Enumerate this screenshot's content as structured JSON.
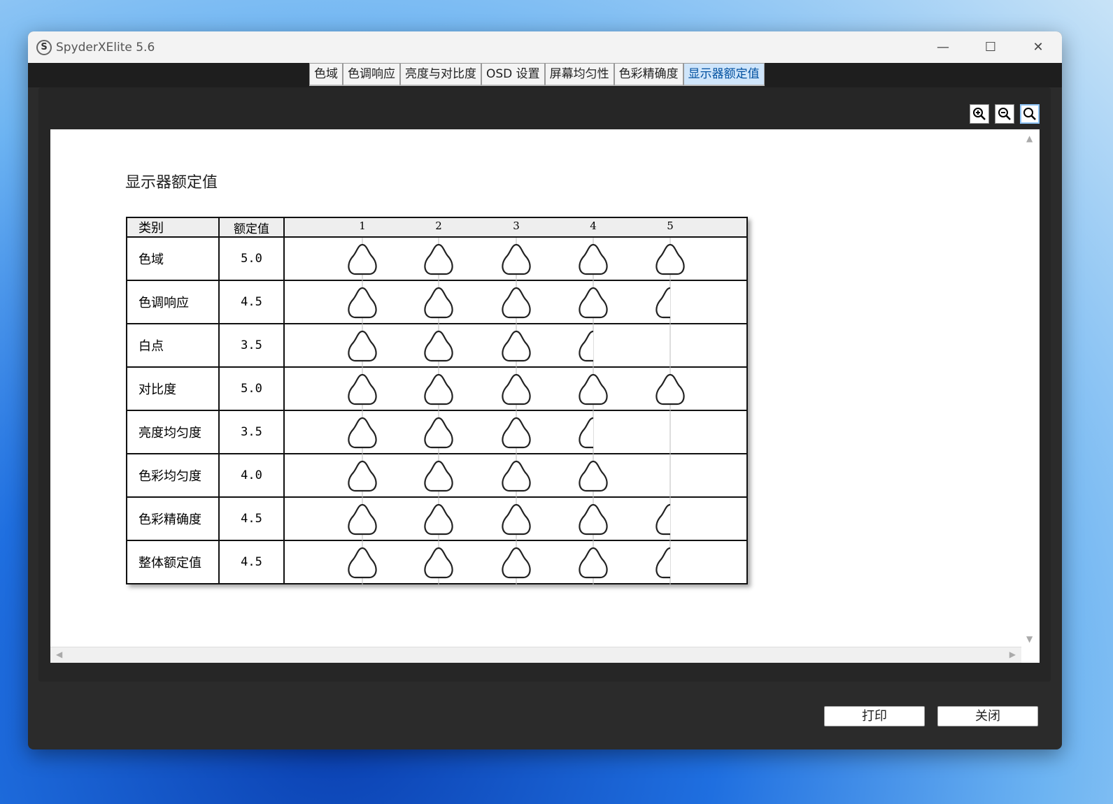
{
  "window": {
    "title": "SpyderXElite 5.6",
    "logo": "S"
  },
  "tabs": [
    "色域",
    "色调响应",
    "亮度与对比度",
    "OSD 设置",
    "屏幕均匀性",
    "色彩精确度",
    "显示器额定值"
  ],
  "active_tab": 6,
  "doc": {
    "title": "显示器额定值",
    "headers": {
      "category": "类别",
      "rating": "额定值",
      "scale": [
        "1",
        "2",
        "3",
        "4",
        "5"
      ]
    },
    "rows": [
      {
        "category": "色域",
        "rating": "5.0",
        "value": 5.0
      },
      {
        "category": "色调响应",
        "rating": "4.5",
        "value": 4.5
      },
      {
        "category": "白点",
        "rating": "3.5",
        "value": 3.5
      },
      {
        "category": "对比度",
        "rating": "5.0",
        "value": 5.0
      },
      {
        "category": "亮度均匀度",
        "rating": "3.5",
        "value": 3.5
      },
      {
        "category": "色彩均匀度",
        "rating": "4.0",
        "value": 4.0
      },
      {
        "category": "色彩精确度",
        "rating": "4.5",
        "value": 4.5
      },
      {
        "category": "整体额定值",
        "rating": "4.5",
        "value": 4.5
      }
    ]
  },
  "buttons": {
    "print": "打印",
    "close": "关闭"
  }
}
